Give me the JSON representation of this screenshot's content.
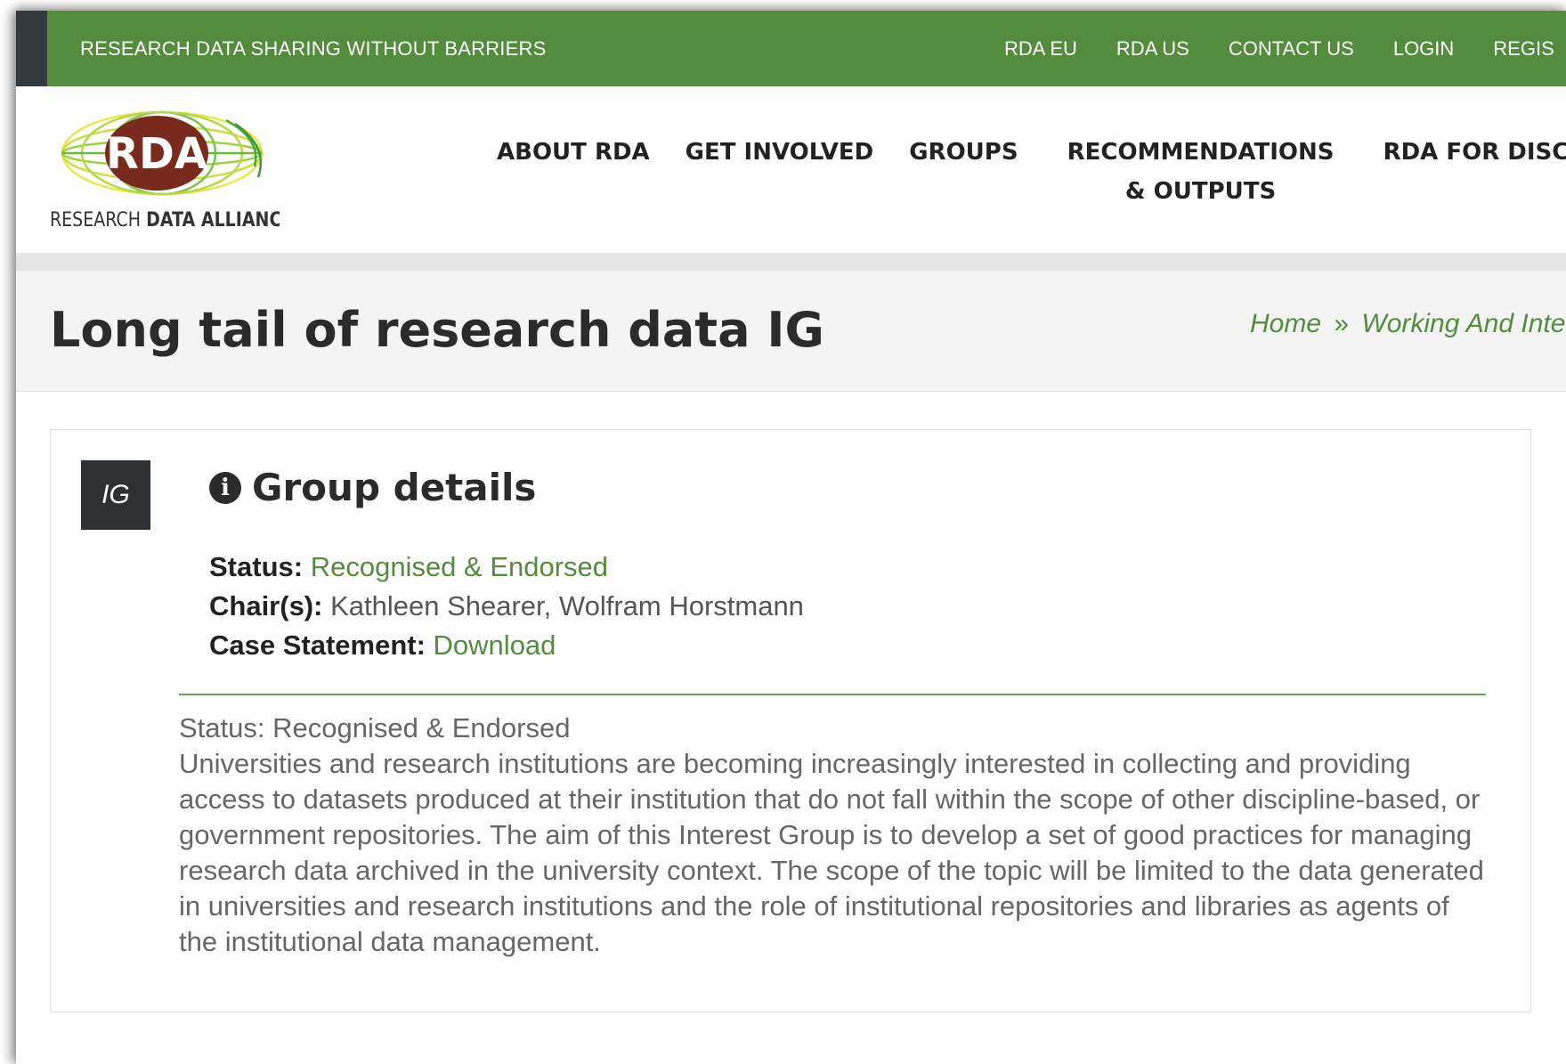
{
  "topbar": {
    "tagline": "RESEARCH DATA SHARING WITHOUT BARRIERS",
    "links": [
      "RDA EU",
      "RDA US",
      "CONTACT US",
      "LOGIN",
      "REGIS"
    ]
  },
  "logo": {
    "mark": "RDA",
    "subtitle_light": "RESEARCH ",
    "subtitle_bold": "DATA ALLIANCE"
  },
  "nav": {
    "items": [
      "ABOUT RDA",
      "GET INVOLVED",
      "GROUPS",
      "RECOMMENDATIONS & OUTPUTS",
      "RDA FOR DISCIP"
    ]
  },
  "page": {
    "title": "Long tail of research data IG",
    "breadcrumb": [
      "Home",
      "Working And Inter"
    ],
    "breadcrumb_sep": "»"
  },
  "group": {
    "badge": "IG",
    "heading": "Group details",
    "status_label": "Status:",
    "status_value": "Recognised & Endorsed",
    "chairs_label": "Chair(s):",
    "chairs_value": "Kathleen Shearer, Wolfram Horstmann",
    "case_label": "Case Statement:",
    "case_value": "Download",
    "desc_status": "Status: Recognised & Endorsed",
    "description": "Universities and research institutions are becoming increasingly interested in collecting and providing access to datasets produced at their institution that do not fall within the scope of other discipline-based, or government repositories. The aim of this Interest Group is to develop a set of good practices for managing research data archived in the university context. The scope of the topic will be limited to the data generated in universities and research institutions and the role of institutional repositories and libraries as agents of the institutional data management."
  },
  "colors": {
    "brand_green": "#528c3c",
    "dark": "#2d3133",
    "logo_red": "#7a2a1c"
  }
}
